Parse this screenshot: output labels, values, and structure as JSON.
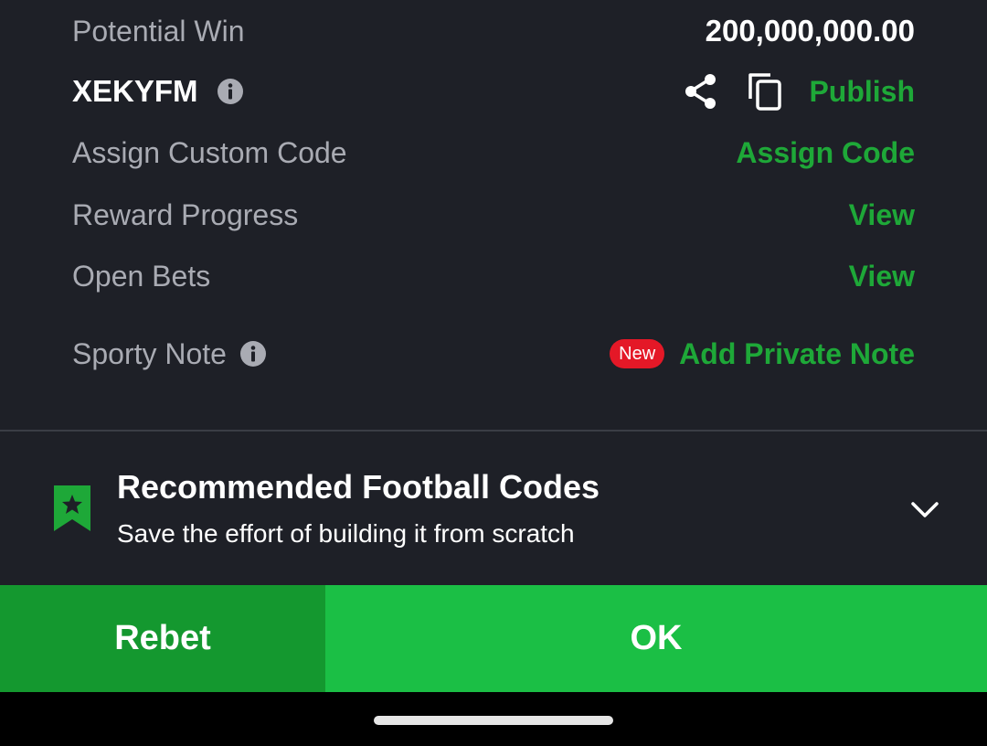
{
  "bet_details": {
    "potential_win_label": "Potential Win",
    "potential_win_value": "200,000,000.00",
    "booking_code": "XEKYFM",
    "publish_label": "Publish",
    "assign_custom_code_label": "Assign Custom Code",
    "assign_code_link": "Assign Code",
    "reward_progress_label": "Reward Progress",
    "reward_progress_link": "View",
    "open_bets_label": "Open Bets",
    "open_bets_link": "View",
    "sporty_note_label": "Sporty Note",
    "new_badge": "New",
    "add_private_note_link": "Add Private Note"
  },
  "recommended": {
    "title": "Recommended Football Codes",
    "subtitle": "Save the effort of building it from scratch"
  },
  "actions": {
    "rebet_label": "Rebet",
    "ok_label": "OK"
  },
  "icons": {
    "info": "info-icon",
    "share": "share-icon",
    "copy": "copy-icon",
    "bookmark": "bookmark-star-icon",
    "chevron": "chevron-down-icon"
  },
  "colors": {
    "background": "#1e2027",
    "accent_green": "#1ea838",
    "rebet_green": "#14982f",
    "ok_green": "#1bbf45",
    "badge_red": "#e41827"
  }
}
